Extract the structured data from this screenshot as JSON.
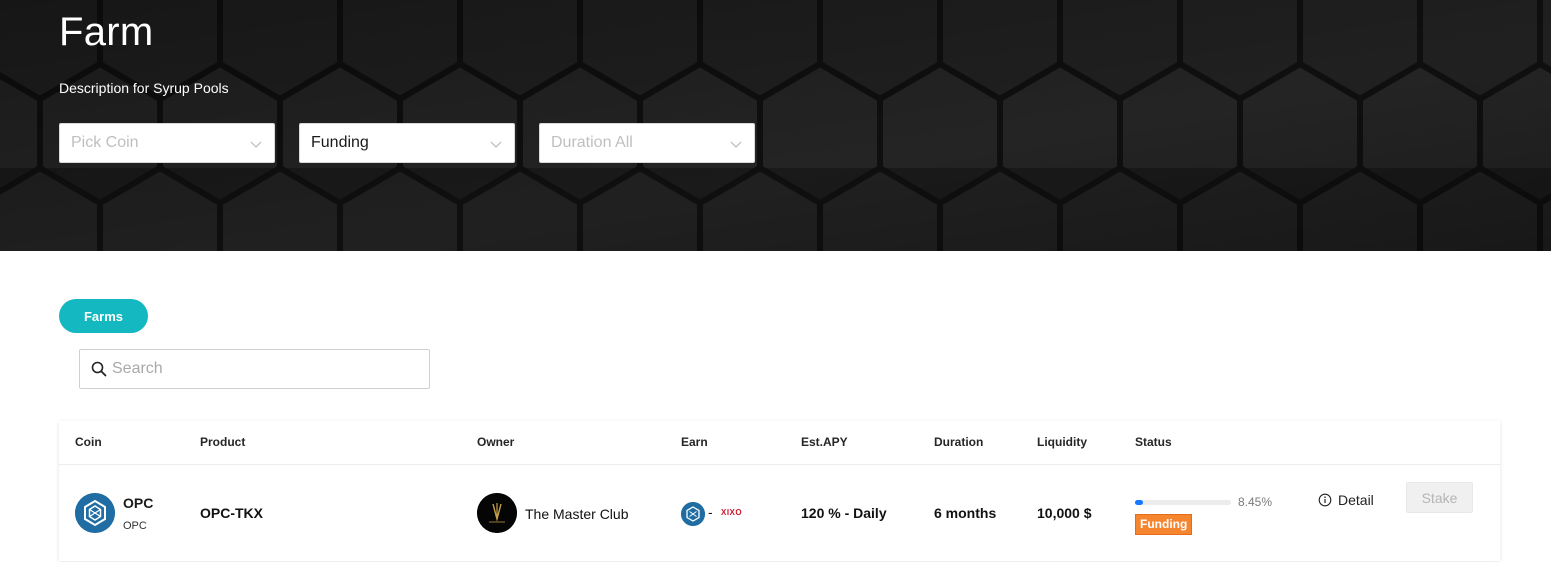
{
  "hero": {
    "title": "Farm",
    "description": "Description for Syrup Pools",
    "filters": {
      "coin_placeholder": "Pick Coin",
      "status_value": "Funding",
      "duration_placeholder": "Duration All"
    }
  },
  "tabs": {
    "farms_label": "Farms"
  },
  "search": {
    "placeholder": "Search",
    "value": ""
  },
  "table": {
    "headers": {
      "coin": "Coin",
      "product": "Product",
      "owner": "Owner",
      "earn": "Earn",
      "apy": "Est.APY",
      "duration": "Duration",
      "liquidity": "Liquidity",
      "status": "Status"
    },
    "rows": [
      {
        "coin_name": "OPC",
        "coin_symbol": "OPC",
        "product": "OPC-TKX",
        "owner": "The Master Club",
        "earn_separator": "-",
        "earn_token": "XIXO",
        "apy": "120 % - Daily",
        "duration": "6 months",
        "liquidity": "10,000 $",
        "progress_fraction": 0.0845,
        "progress_text": "8.45%",
        "status": "Funding",
        "detail_label": "Detail",
        "stake_label": "Stake"
      }
    ]
  },
  "colors": {
    "accent": "#13b8c0",
    "status_funding": "#f5852f",
    "progress": "#1677ff",
    "coin_blue": "#1f6da3"
  },
  "icons": [
    "chevron-down-icon",
    "search-icon",
    "info-icon",
    "opc-coin-icon",
    "master-club-logo",
    "xixo-token-icon"
  ]
}
